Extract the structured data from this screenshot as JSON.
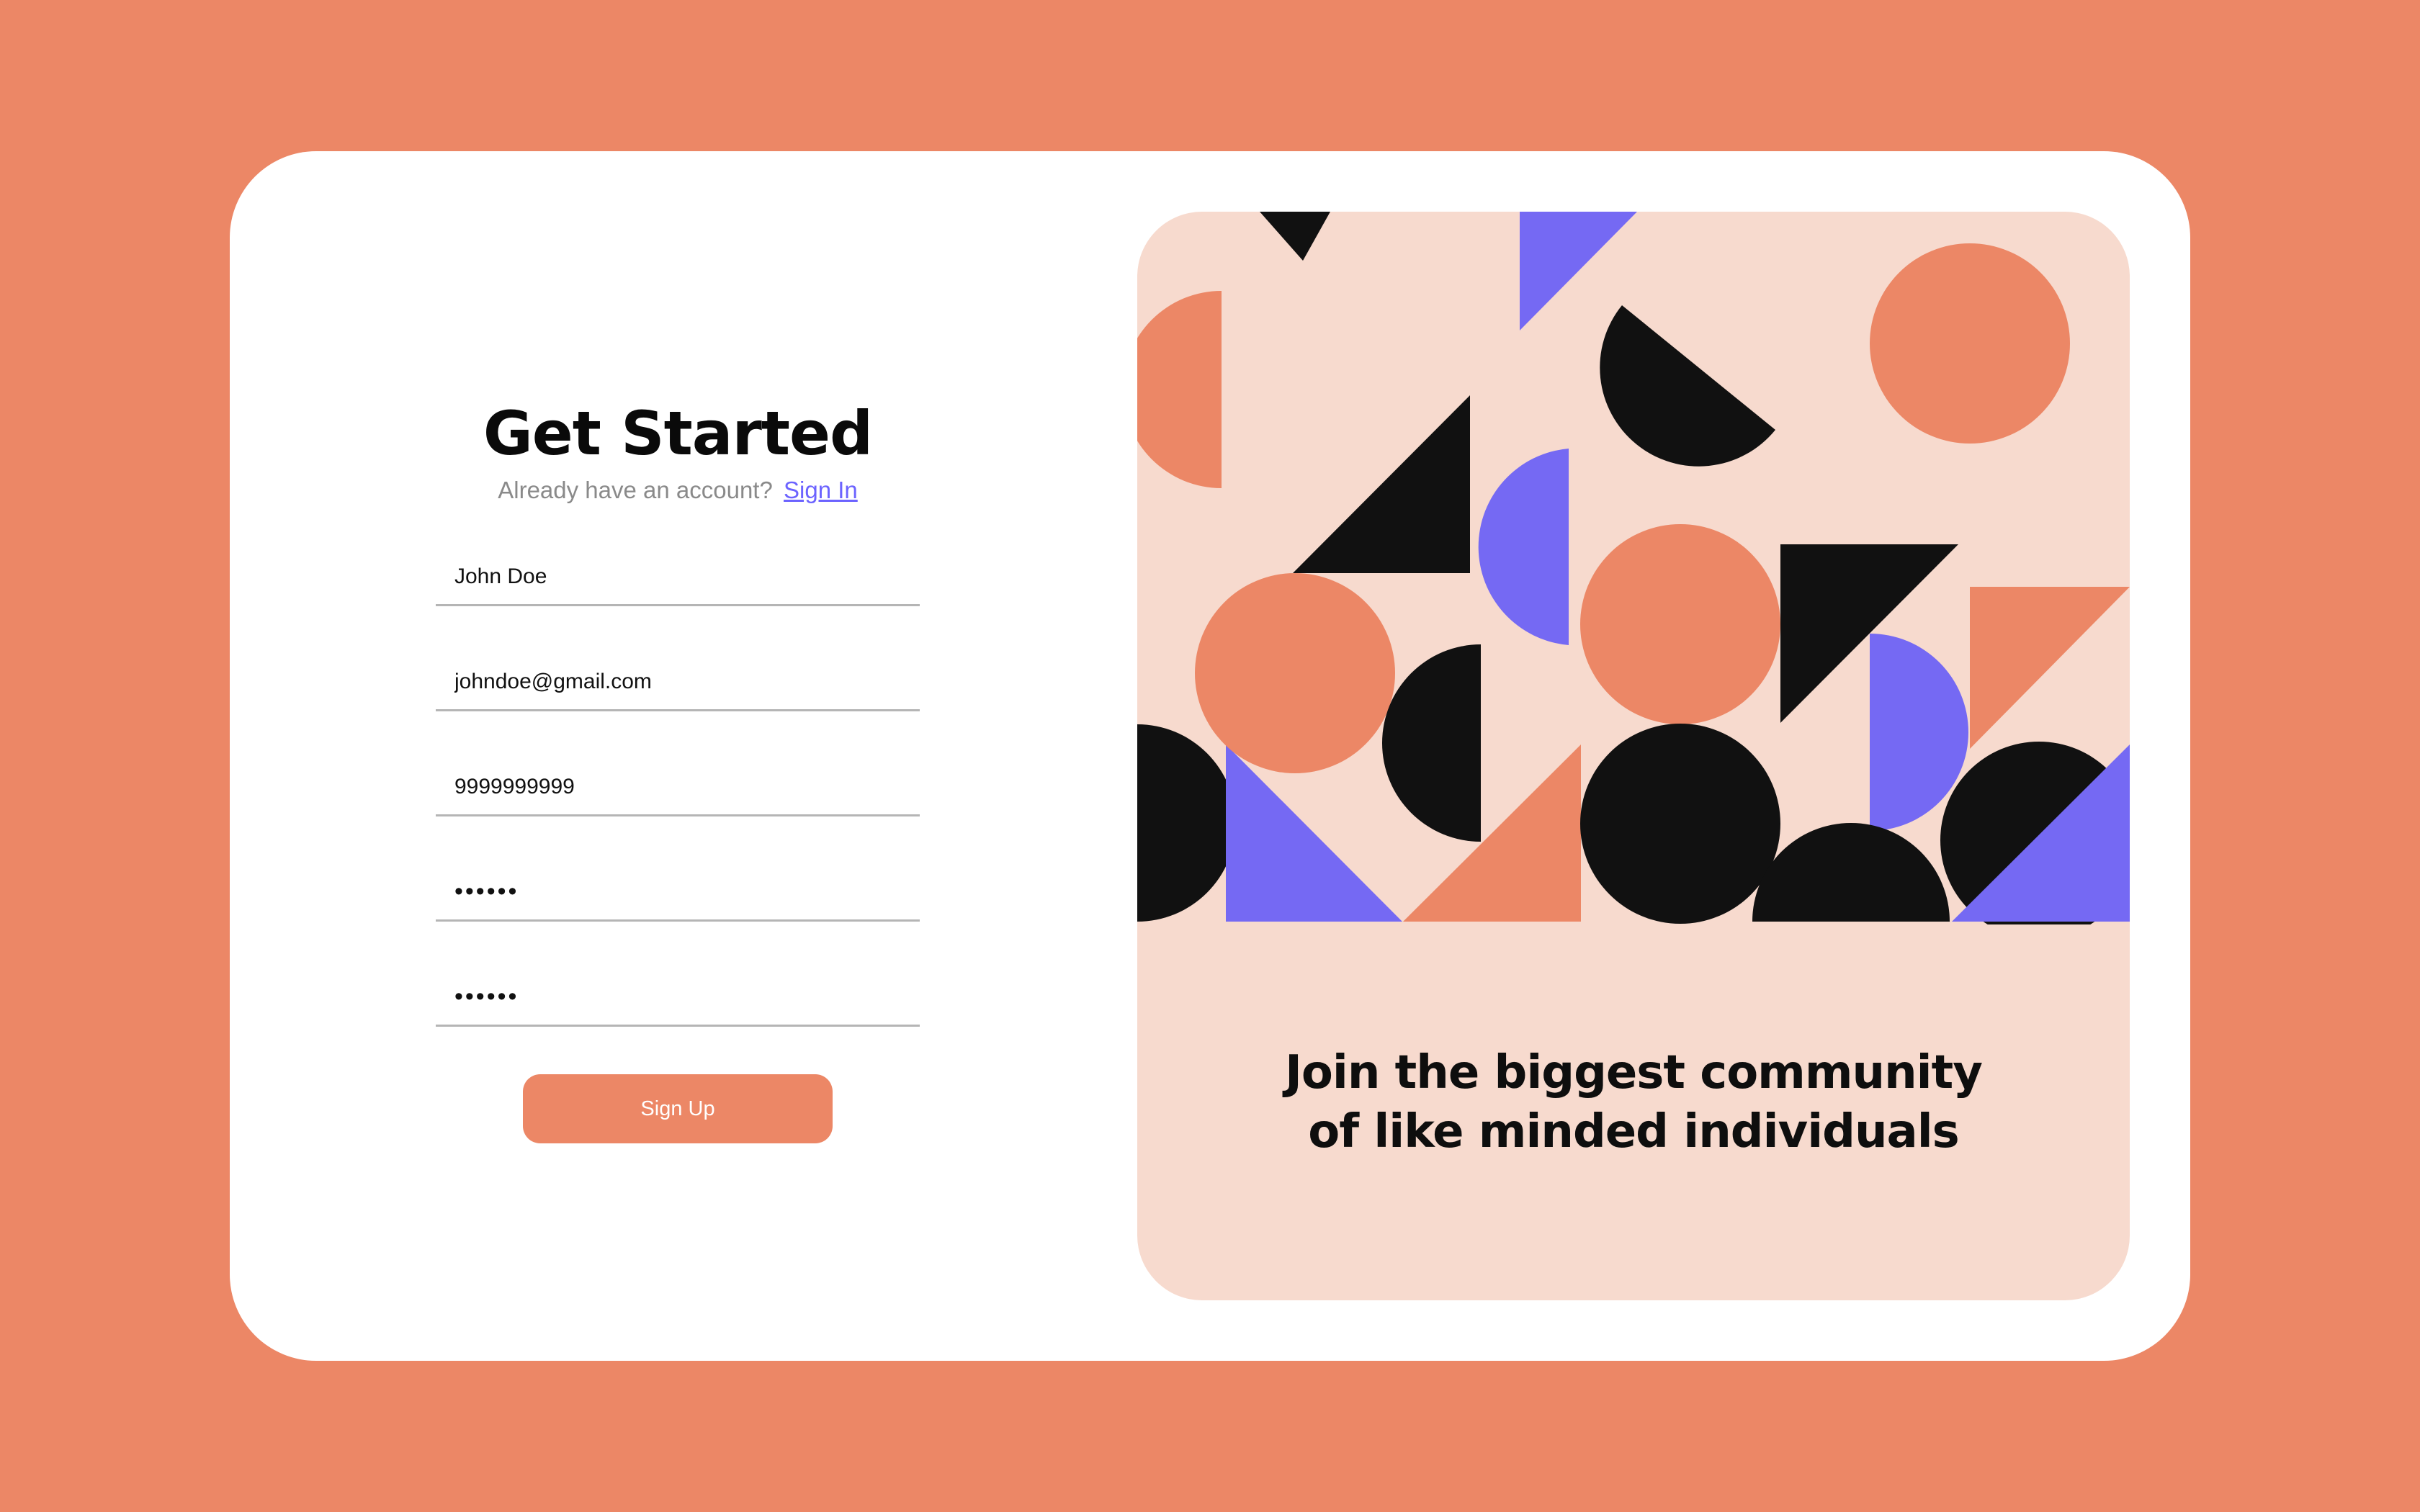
{
  "colors": {
    "background": "#EC8766",
    "card": "#FFFFFF",
    "accent": "#EC8766",
    "link": "#6C63FF",
    "art_background": "#F7DACE",
    "art_black": "#111111",
    "art_purple": "#7569F3",
    "art_orange": "#EC8766"
  },
  "signup": {
    "title": "Get Started",
    "subtitle": "Already have an account?",
    "signin_link": "Sign In",
    "fields": {
      "name": "John Doe",
      "email": "johndoe@gmail.com",
      "phone": "9999999999",
      "password": "••••••",
      "confirm_password": "••••••"
    },
    "submit_label": "Sign Up"
  },
  "promo": {
    "tagline_line1": "Join the biggest community",
    "tagline_line2": "of like minded individuals"
  }
}
